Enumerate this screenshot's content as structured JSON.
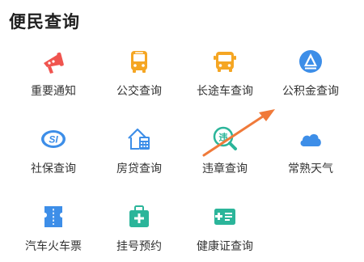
{
  "section": {
    "title": "便民查询"
  },
  "items": [
    {
      "label": "重要通知",
      "icon": "megaphone-icon",
      "color": "#f0544f"
    },
    {
      "label": "公交查询",
      "icon": "bus-icon",
      "color": "#f5a623"
    },
    {
      "label": "长途车查询",
      "icon": "coach-icon",
      "color": "#f5a623"
    },
    {
      "label": "公积金查询",
      "icon": "housing-fund-logo-icon",
      "color": "#3d8ee8"
    },
    {
      "label": "社保查询",
      "icon": "social-security-logo-icon",
      "color": "#3d8ee8"
    },
    {
      "label": "房贷查询",
      "icon": "house-calculator-icon",
      "color": "#3d8ee8"
    },
    {
      "label": "违章查询",
      "icon": "traffic-violation-search-icon",
      "color": "#2bb59a"
    },
    {
      "label": "常熟天气",
      "icon": "cloud-icon",
      "color": "#3d8ee8"
    },
    {
      "label": "汽车火车票",
      "icon": "ticket-icon",
      "color": "#3d8ee8"
    },
    {
      "label": "挂号预约",
      "icon": "medical-kit-icon",
      "color": "#2bb59a"
    },
    {
      "label": "健康证查询",
      "icon": "health-card-icon",
      "color": "#2bb59a"
    }
  ],
  "annotation": {
    "arrow_color": "#f07a3a"
  }
}
